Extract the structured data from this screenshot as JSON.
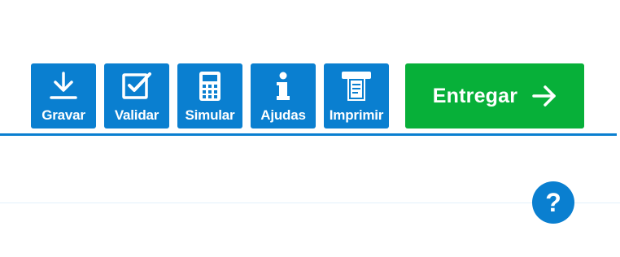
{
  "toolbar": {
    "buttons": [
      {
        "label": "Gravar",
        "icon": "download-icon"
      },
      {
        "label": "Validar",
        "icon": "checkbox-icon"
      },
      {
        "label": "Simular",
        "icon": "calculator-icon"
      },
      {
        "label": "Ajudas",
        "icon": "info-icon"
      },
      {
        "label": "Imprimir",
        "icon": "printer-icon"
      }
    ],
    "submit": {
      "label": "Entregar",
      "icon": "arrow-right-icon"
    }
  },
  "help": {
    "label": "?"
  },
  "colors": {
    "primary": "#0a7fd0",
    "submit": "#07b039",
    "text_on_button": "#ffffff"
  }
}
